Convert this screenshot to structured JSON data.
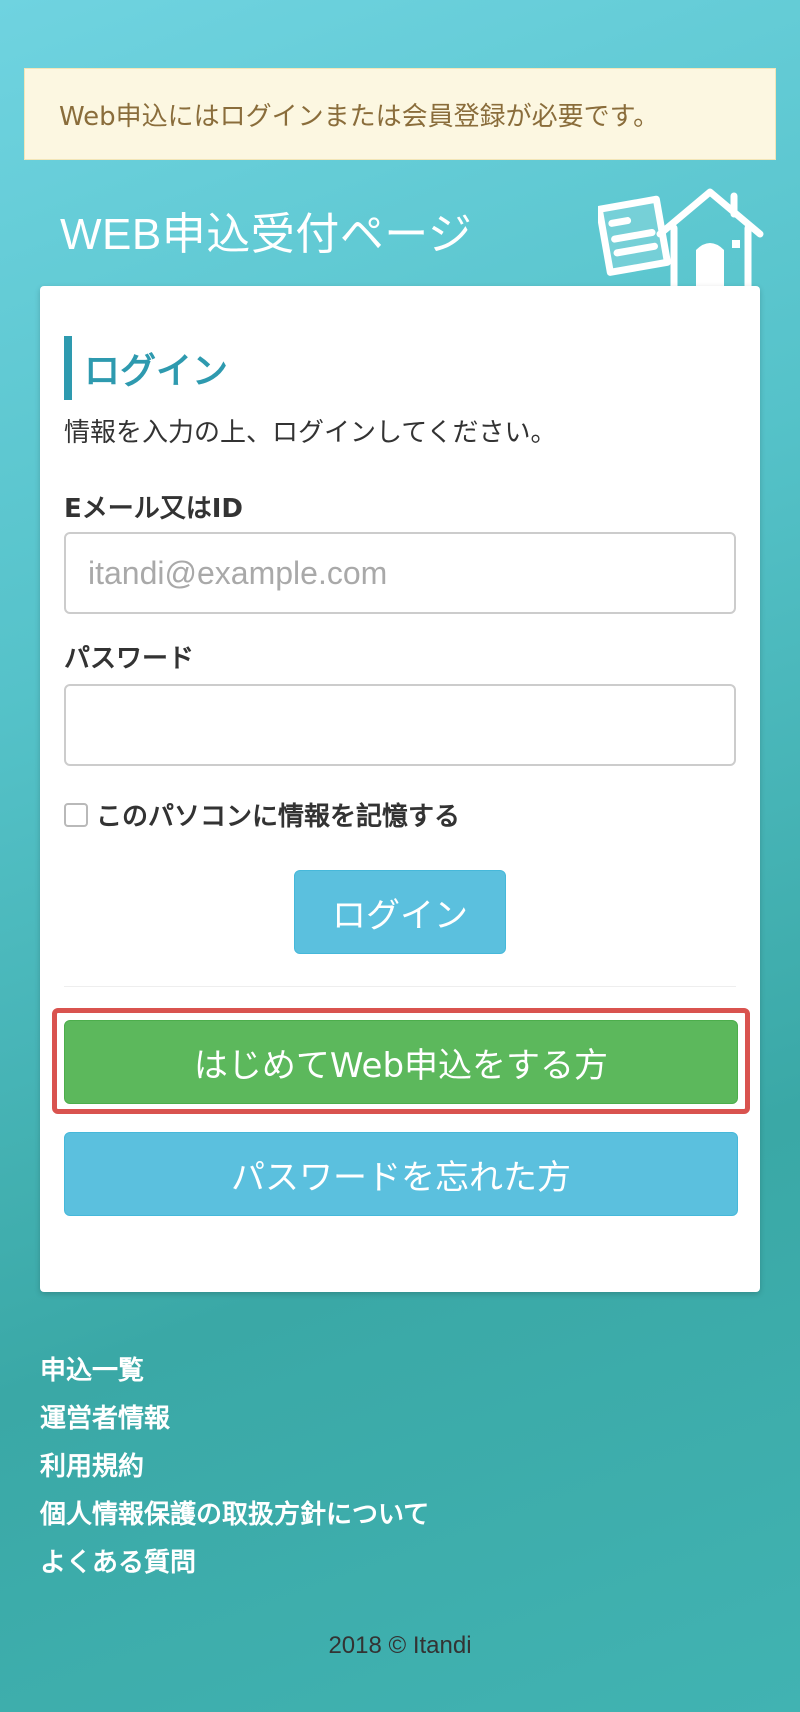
{
  "alert": {
    "message": "Web申込にはログインまたは会員登録が必要です。"
  },
  "header": {
    "title": "WEB申込受付ページ",
    "illustration": "house-document-icon"
  },
  "login": {
    "heading": "ログイン",
    "intro": "情報を入力の上、ログインしてください。",
    "email_label": "Eメール又はID",
    "email_placeholder": "itandi@example.com",
    "email_value": "",
    "password_label": "パスワード",
    "password_value": "",
    "remember_label": "このパソコンに情報を記憶する",
    "remember_checked": false,
    "submit_label": "ログイン"
  },
  "actions": {
    "signup_label": "はじめてWeb申込をする方",
    "forgot_label": "パスワードを忘れた方"
  },
  "footer": {
    "links": [
      {
        "label": "申込一覧"
      },
      {
        "label": "運営者情報"
      },
      {
        "label": "利用規約"
      },
      {
        "label": "個人情報保護の取扱方針について"
      },
      {
        "label": "よくある質問"
      }
    ],
    "copyright": "2018 © Itandi"
  },
  "colors": {
    "info": "#5bc0de",
    "success": "#5cb85c",
    "highlight": "#d9534f",
    "heading_accent": "#2e9aaf",
    "alert_bg": "#fcf7e1",
    "alert_text": "#8a6d3b"
  }
}
